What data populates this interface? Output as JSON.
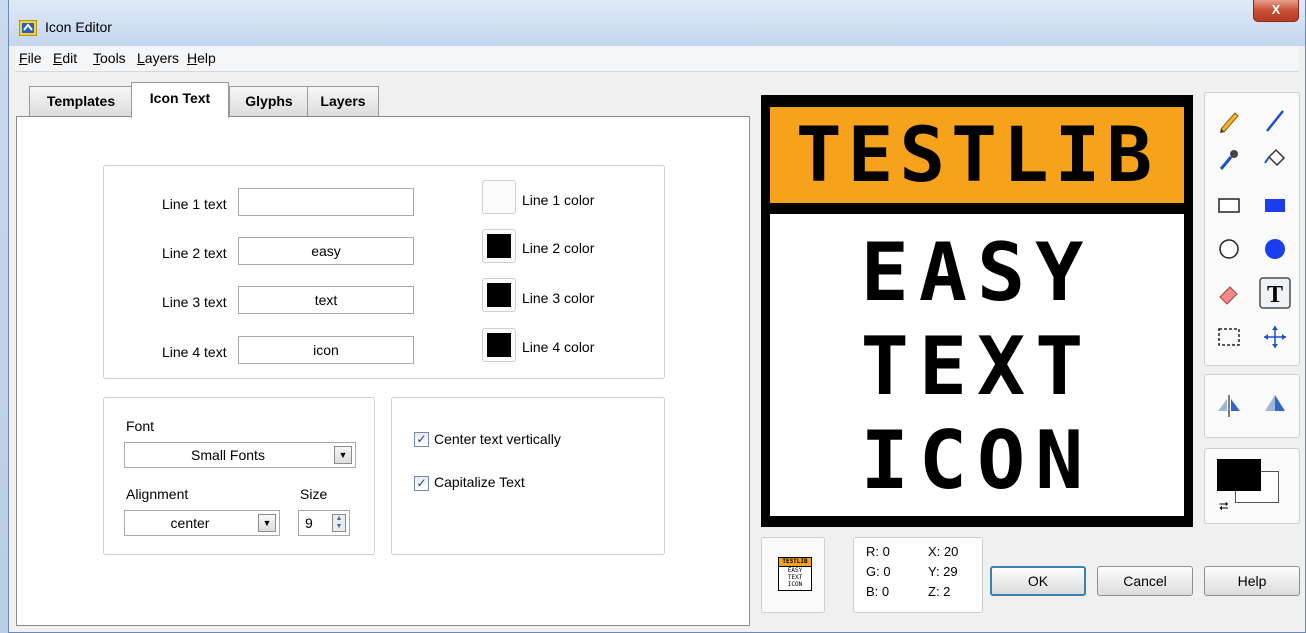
{
  "window": {
    "title": "Icon Editor",
    "close_label": "X"
  },
  "menu": [
    "File",
    "Edit",
    "Tools",
    "Layers",
    "Help"
  ],
  "tabs": [
    "Templates",
    "Icon Text",
    "Glyphs",
    "Layers"
  ],
  "active_tab": "Icon Text",
  "icon_text": {
    "lines": [
      {
        "label": "Line 1 text",
        "value": "",
        "color_label": "Line 1 color",
        "color": "none"
      },
      {
        "label": "Line 2 text",
        "value": "easy",
        "color_label": "Line 2 color",
        "color": "#000000"
      },
      {
        "label": "Line 3 text",
        "value": "text",
        "color_label": "Line 3 color",
        "color": "#000000"
      },
      {
        "label": "Line 4 text",
        "value": "icon",
        "color_label": "Line 4 color",
        "color": "#000000"
      }
    ],
    "font_label": "Font",
    "font_value": "Small Fonts",
    "alignment_label": "Alignment",
    "alignment_value": "center",
    "size_label": "Size",
    "size_value": "9",
    "center_vertically_label": "Center text vertically",
    "center_vertically_checked": true,
    "capitalize_label": "Capitalize Text",
    "capitalize_checked": true
  },
  "canvas": {
    "banner_text": "TESTLIB",
    "banner_color": "#f7a21b",
    "lines": [
      "EASY",
      "TEXT",
      "ICON"
    ]
  },
  "preview": {
    "banner": "TESTLIB",
    "lines": [
      "EASY",
      "TEXT",
      "ICON"
    ]
  },
  "readout": {
    "r": "R: 0",
    "g": "G: 0",
    "b": "B: 0",
    "x": "X: 20",
    "y": "Y: 29",
    "z": "Z: 2"
  },
  "buttons": {
    "ok": "OK",
    "cancel": "Cancel",
    "help": "Help"
  },
  "tools": [
    "pencil-icon",
    "line-icon",
    "color-picker-icon",
    "fill-icon",
    "rectangle-icon",
    "filled-rectangle-icon",
    "ellipse-icon",
    "filled-ellipse-icon",
    "eraser-icon",
    "text-tool-icon",
    "selection-icon",
    "move-icon",
    "flip-horizontal-icon",
    "rotate-icon"
  ],
  "colors": {
    "foreground": "#000000",
    "background": "#ffffff",
    "accent": "#f7a21b"
  }
}
